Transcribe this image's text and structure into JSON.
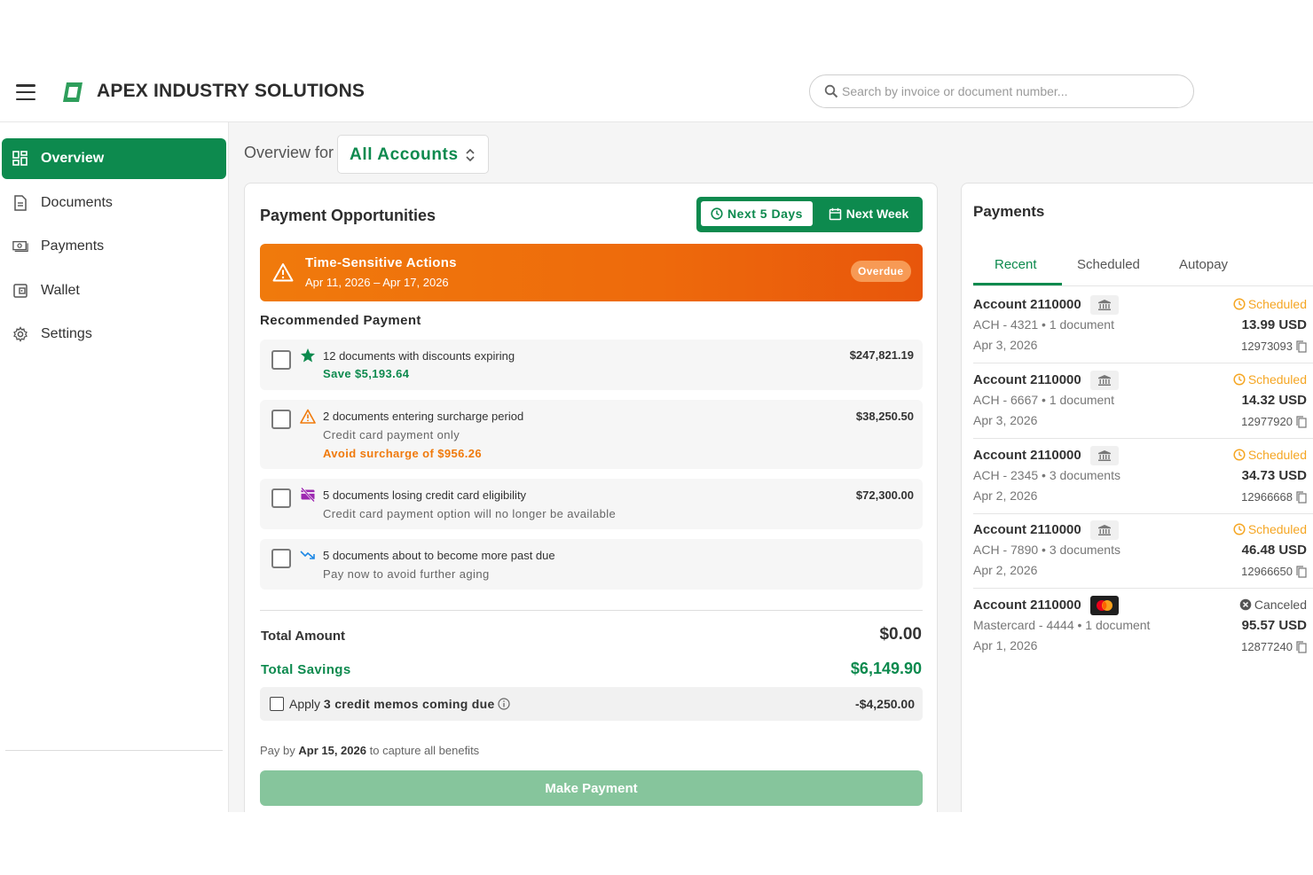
{
  "header": {
    "brand": "APEX INDUSTRY SOLUTIONS",
    "search_placeholder": "Search by invoice or document number..."
  },
  "sidebar": {
    "items": [
      {
        "label": "Overview",
        "icon": "grid-icon",
        "active": true
      },
      {
        "label": "Documents",
        "icon": "document-icon"
      },
      {
        "label": "Payments",
        "icon": "cash-icon"
      },
      {
        "label": "Wallet",
        "icon": "wallet-icon"
      },
      {
        "label": "Settings",
        "icon": "gear-icon"
      }
    ]
  },
  "overview": {
    "label": "Overview for",
    "account": "All Accounts"
  },
  "opportunities": {
    "title": "Payment Opportunities",
    "toggle": {
      "option1": "Next 5 Days",
      "option2": "Next Week",
      "selected": "Next 5 Days"
    },
    "alert": {
      "title": "Time-Sensitive Actions",
      "date_range": "Apr 11, 2026 – Apr 17, 2026",
      "badge": "Overdue"
    },
    "recommended_title": "Recommended Payment",
    "rows": [
      {
        "icon": "star-icon",
        "line1": "12 documents with discounts expiring",
        "line2": "",
        "line3": "Save $5,193.64",
        "amount": "$247,821.19"
      },
      {
        "icon": "warning-icon",
        "line1": "2 documents entering surcharge period",
        "line2": "Credit card payment only",
        "line3": "Avoid surcharge of $956.26",
        "amount": "$38,250.50"
      },
      {
        "icon": "card-off-icon",
        "line1": "5 documents losing credit card eligibility",
        "line2": "Credit card payment option will no longer be available",
        "line3": "",
        "amount": "$72,300.00"
      },
      {
        "icon": "trending-down-icon",
        "line1": "5 documents about to become more past due",
        "line2": "Pay now to avoid further aging",
        "line3": "",
        "amount": ""
      }
    ],
    "total_label": "Total Amount",
    "total_value": "$0.00",
    "savings_label": "Total Savings",
    "savings_value": "$6,149.90",
    "memo": {
      "prefix": "Apply",
      "bold": "3 credit memos coming due",
      "amount": "-$4,250.00"
    },
    "payby": {
      "prefix": "Pay by",
      "date": "Apr 15, 2026",
      "suffix": "to capture all benefits"
    },
    "button": "Make Payment"
  },
  "payments": {
    "title": "Payments",
    "tabs": [
      "Recent",
      "Scheduled",
      "Autopay"
    ],
    "active_tab": "Recent",
    "rows": [
      {
        "account": "Account 2110000",
        "method_icon": "bank-icon",
        "method": "ACH - 4321 • 1 document",
        "date": "Apr 3, 2026",
        "status": "Scheduled",
        "amount": "13.99 USD",
        "id": "12973093"
      },
      {
        "account": "Account 2110000",
        "method_icon": "bank-icon",
        "method": "ACH - 6667 • 1 document",
        "date": "Apr 3, 2026",
        "status": "Scheduled",
        "amount": "14.32 USD",
        "id": "12977920"
      },
      {
        "account": "Account 2110000",
        "method_icon": "bank-icon",
        "method": "ACH - 2345 • 3 documents",
        "date": "Apr 2, 2026",
        "status": "Scheduled",
        "amount": "34.73 USD",
        "id": "12966668"
      },
      {
        "account": "Account 2110000",
        "method_icon": "bank-icon",
        "method": "ACH - 7890 • 3 documents",
        "date": "Apr 2, 2026",
        "status": "Scheduled",
        "amount": "46.48 USD",
        "id": "12966650"
      },
      {
        "account": "Account 2110000",
        "method_icon": "mastercard-icon",
        "method": "Mastercard - 4444 • 1 document",
        "date": "Apr 1, 2026",
        "status": "Canceled",
        "amount": "95.57 USD",
        "id": "12877240"
      }
    ]
  },
  "colors": {
    "brand_green": "#0d8a4e",
    "alert_orange": "#f07a0c",
    "scheduled": "#f5a623"
  }
}
